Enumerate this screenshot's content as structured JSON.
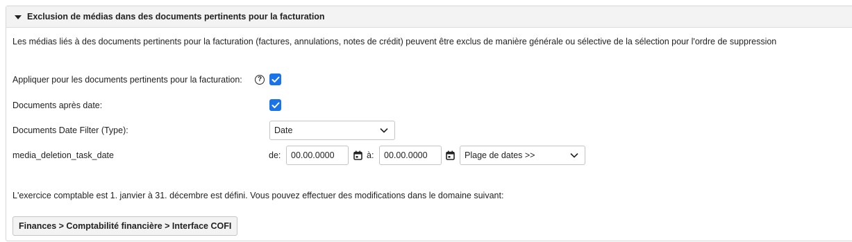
{
  "section": {
    "title": "Exclusion de médias dans des documents pertinents pour la facturation",
    "description": "Les médias liés à des documents pertinents pour la facturation (factures, annulations, notes de crédit) peuvent être exclus de manière générale ou sélective de la sélection pour l'ordre de suppression"
  },
  "fields": {
    "apply_label": "Appliquer pour les documents pertinents pour la facturation:",
    "apply_checked": true,
    "after_date_label": "Documents après date:",
    "after_date_checked": true,
    "filter_type_label": "Documents Date Filter (Type):",
    "filter_type_value": "Date",
    "task_date_label": "media_deletion_task_date",
    "from_label": "de:",
    "from_value": "00.00.0000",
    "to_label": "à:",
    "to_value": "00.00.0000",
    "range_value": "Plage de dates >>"
  },
  "info_text": "L'exercice comptable est 1. janvier à 31. décembre est défini. Vous pouvez effectuer des modifications dans le domaine suivant:",
  "nav_button": "Finances > Comptabilité financière > Interface COFI",
  "colors": {
    "accent": "#1a73e8",
    "header_bg": "#f3f3f3",
    "border": "#c4c4c4"
  },
  "icons": {
    "collapse": "caret-down-icon",
    "help": "question-circle-icon",
    "calendar": "calendar-icon",
    "dropdown": "chevron-down-icon",
    "check": "check-icon"
  }
}
